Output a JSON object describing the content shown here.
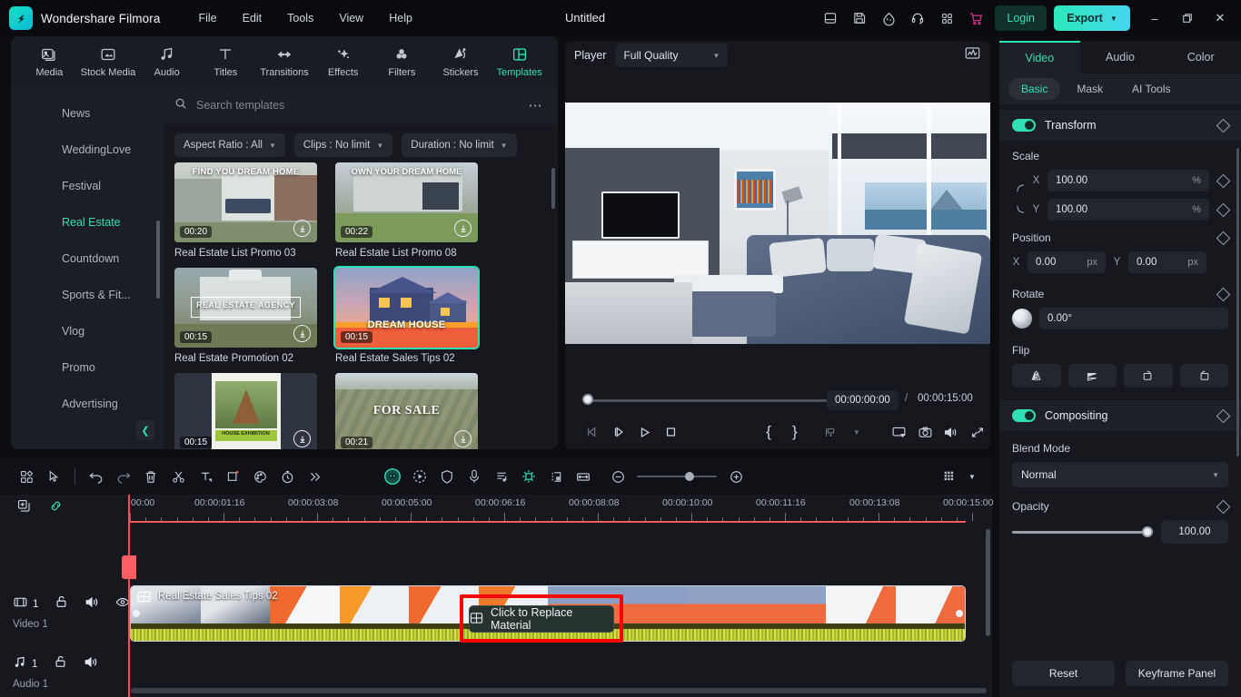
{
  "titlebar": {
    "brand": "Wondershare Filmora",
    "logo_icon": "filmora-logo-icon",
    "menus": [
      "File",
      "Edit",
      "Tools",
      "View",
      "Help"
    ],
    "document_title": "Untitled",
    "icons": [
      "save-project-icon",
      "save-as-icon",
      "cloud-backup-icon",
      "support-headset-icon",
      "apps-grid-icon",
      "shopping-cart-icon"
    ],
    "login_label": "Login",
    "export_label": "Export",
    "window_controls": [
      "minimize-icon",
      "restore-icon",
      "close-icon"
    ]
  },
  "navtabs": [
    {
      "label": "Media",
      "icon": "media-icon",
      "active": false
    },
    {
      "label": "Stock Media",
      "icon": "stock-media-icon",
      "active": false
    },
    {
      "label": "Audio",
      "icon": "audio-note-icon",
      "active": false
    },
    {
      "label": "Titles",
      "icon": "titles-t-icon",
      "active": false
    },
    {
      "label": "Transitions",
      "icon": "transitions-arrows-icon",
      "active": false
    },
    {
      "label": "Effects",
      "icon": "effects-sparkle-icon",
      "active": false
    },
    {
      "label": "Filters",
      "icon": "filters-circles-icon",
      "active": false
    },
    {
      "label": "Stickers",
      "icon": "stickers-icon",
      "active": false
    },
    {
      "label": "Templates",
      "icon": "templates-layout-icon",
      "active": true
    }
  ],
  "categories": [
    {
      "label": "News",
      "active": false
    },
    {
      "label": "WeddingLove",
      "active": false
    },
    {
      "label": "Festival",
      "active": false
    },
    {
      "label": "Real Estate",
      "active": true
    },
    {
      "label": "Countdown",
      "active": false
    },
    {
      "label": "Sports & Fit...",
      "active": false
    },
    {
      "label": "Vlog",
      "active": false
    },
    {
      "label": "Promo",
      "active": false
    },
    {
      "label": "Advertising",
      "active": false
    }
  ],
  "collapse_icon": "chevron-left-icon",
  "search": {
    "placeholder": "Search templates",
    "icon": "search-icon",
    "more_icon": "more-options-icon"
  },
  "filters": [
    {
      "label": "Aspect Ratio : All"
    },
    {
      "label": "Clips : No limit"
    },
    {
      "label": "Duration : No limit"
    }
  ],
  "templates": [
    {
      "name": "Real Estate List Promo 03",
      "duration": "00:20",
      "caption": "FIND YOU DREAM HOME",
      "selected": false,
      "theme": "patio"
    },
    {
      "name": "Real Estate List Promo 08",
      "duration": "00:22",
      "caption": "OWN YOUR DREAM HOME",
      "selected": false,
      "theme": "lawn"
    },
    {
      "name": "Real Estate Promotion 02",
      "duration": "00:15",
      "caption": "REAL ESTATE AGENCY",
      "selected": false,
      "theme": "mansion"
    },
    {
      "name": "Real Estate Sales Tips 02",
      "duration": "00:15",
      "caption": "DREAM HOUSE",
      "selected": true,
      "theme": "house"
    },
    {
      "name": "",
      "duration": "00:15",
      "caption": "HOUSE EXHIBITION",
      "selected": false,
      "theme": "poster"
    },
    {
      "name": "",
      "duration": "00:21",
      "caption": "FOR SALE",
      "selected": false,
      "theme": "aerial"
    }
  ],
  "player": {
    "label": "Player",
    "quality": "Full Quality",
    "quality_chevron_icon": "chevron-down-icon",
    "scope_icon": "waveform-scope-icon",
    "current_time": "00:00:00:00",
    "separator": "/",
    "total_time": "00:00:15:00",
    "controls": [
      {
        "icon": "prev-frame-icon",
        "dim": true
      },
      {
        "icon": "next-frame-icon",
        "dim": false
      },
      {
        "icon": "play-icon",
        "dim": false
      },
      {
        "icon": "stop-icon",
        "dim": false
      },
      {
        "icon": "mark-in-icon",
        "dim": false
      },
      {
        "icon": "mark-out-icon",
        "dim": false
      },
      {
        "icon": "snapshot-marker-icon",
        "dim": true
      },
      {
        "icon": "chevron-down-small-icon",
        "dim": true
      },
      {
        "icon": "display-mode-icon",
        "dim": false
      },
      {
        "icon": "camera-snapshot-icon",
        "dim": false
      },
      {
        "icon": "volume-icon",
        "dim": false
      },
      {
        "icon": "fullscreen-icon",
        "dim": false
      }
    ]
  },
  "properties": {
    "tabs": [
      {
        "label": "Video",
        "active": true
      },
      {
        "label": "Audio",
        "active": false
      },
      {
        "label": "Color",
        "active": false
      }
    ],
    "sub_tabs": [
      {
        "label": "Basic",
        "active": true
      },
      {
        "label": "Mask",
        "active": false
      },
      {
        "label": "AI Tools",
        "active": false
      }
    ],
    "transform": {
      "title": "Transform",
      "keyframe_icon": "keyframe-diamond-icon",
      "scale_label": "Scale",
      "lock_icon": "link-lock-icon",
      "scale_x_axis": "X",
      "scale_x": "100.00",
      "scale_y_axis": "Y",
      "scale_y": "100.00",
      "percent_unit": "%",
      "position_label": "Position",
      "pos_x_axis": "X",
      "pos_x": "0.00",
      "pos_y_axis": "Y",
      "pos_y": "0.00",
      "px_unit": "px",
      "rotate_label": "Rotate",
      "rotate_value": "0.00°",
      "flip_label": "Flip",
      "flip_buttons": [
        "flip-horizontal-icon",
        "flip-vertical-icon",
        "rotate-right-icon",
        "rotate-left-icon"
      ]
    },
    "compositing": {
      "title": "Compositing",
      "blend_label": "Blend Mode",
      "blend_value": "Normal",
      "opacity_label": "Opacity",
      "opacity_value": "100.00"
    },
    "footer": {
      "reset_label": "Reset",
      "keyframe_panel_label": "Keyframe Panel"
    }
  },
  "timeline_toolbar": {
    "left_icons": [
      "layout-grid-icon",
      "select-tool-icon"
    ],
    "edit_icons": [
      "undo-icon",
      "redo-icon",
      "delete-icon",
      "split-scissors-icon",
      "text-tool-icon",
      "crop-tool-icon",
      "color-palette-icon",
      "speed-timer-icon",
      "more-chevrons-icon"
    ],
    "right_icons": [
      "ai-mask-icon",
      "motion-tracking-icon",
      "shield-icon",
      "voiceover-mic-icon",
      "auto-beat-icon",
      "keyframe-green-icon",
      "scene-detect-icon",
      "fit-to-window-icon"
    ],
    "zoom_out_icon": "zoom-out-icon",
    "zoom_in_icon": "zoom-in-icon",
    "marker_icon": "marker-grid-icon",
    "marker_chevron_icon": "chevron-down-small-icon"
  },
  "timeline": {
    "header_tools": [
      "add-track-icon",
      "link-chain-icon"
    ],
    "ruler_labels": [
      "00:00",
      "00:00:01:16",
      "00:00:03:08",
      "00:00:05:00",
      "00:00:06:16",
      "00:00:08:08",
      "00:00:10:00",
      "00:00:11:16",
      "00:00:13:08",
      "00:00:15:00"
    ],
    "tracks": [
      {
        "name": "Video 1",
        "count": "1",
        "type_icon": "video-track-icon",
        "lock_icon": "unlock-icon",
        "mute_icon": "speaker-icon",
        "eye_icon": "eye-icon"
      },
      {
        "name": "Audio 1",
        "count": "1",
        "type_icon": "audio-track-icon",
        "lock_icon": "unlock-icon",
        "mute_icon": "speaker-icon"
      }
    ],
    "clip": {
      "title": "Real Estate Sales Tips 02",
      "icon": "template-clip-icon"
    },
    "replace_button": {
      "label": "Click to Replace Material",
      "icon": "replace-material-icon"
    }
  },
  "colors": {
    "accent": "#2fe0b5",
    "export_gradient_start": "#2ce8ba",
    "export_gradient_end": "#45d6f0",
    "playhead_red": "#ff4d4f",
    "highlight_red": "#ff0000",
    "panel_bg": "#16181d",
    "app_bg": "#0c0d10"
  }
}
